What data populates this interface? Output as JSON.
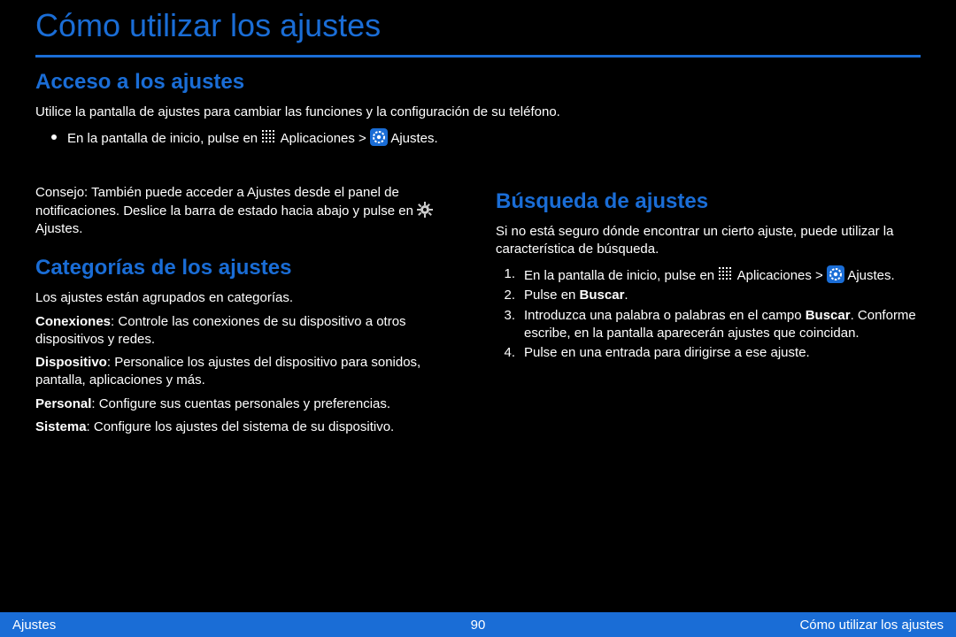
{
  "title": "Cómo utilizar los ajustes",
  "sections": {
    "acceso": {
      "heading": "Acceso a los ajustes",
      "intro": "Utilice la pantalla de ajustes para cambiar las funciones y la configuración de su teléfono.",
      "bullet_before": "En la pantalla de inicio, pulse en ",
      "bullet_middle": " Aplicaciones > ",
      "bullet_after": " Ajustes.",
      "tip_before": "Consejo: También puede acceder a Ajustes desde el panel de notificaciones. Deslice la barra de estado hacia abajo y pulse en ",
      "tip_after": " Ajustes."
    },
    "categorias": {
      "heading": "Categorías de los ajustes",
      "p1": "Los ajustes están agrupados en categorías.",
      "p2_before": "Conexiones",
      "p2_after": ": Controle las conexiones de su dispositivo a otros dispositivos y redes.",
      "p3_before": "Dispositivo",
      "p3_after": ": Personalice los ajustes del dispositivo para sonidos, pantalla, aplicaciones y más.",
      "p4_before": "Personal",
      "p4_after": ": Configure sus cuentas personales y preferencias.",
      "p5_before": "Sistema",
      "p5_after": ": Configure los ajustes del sistema de su dispositivo."
    },
    "busqueda": {
      "heading": "Búsqueda de ajustes",
      "intro": "Si no está seguro dónde encontrar un cierto ajuste, puede utilizar la característica de búsqueda.",
      "list": [
        {
          "n": "1.",
          "before": "En la pantalla de inicio, pulse en ",
          "mid": " Aplicaciones > ",
          "after": " Ajustes."
        },
        {
          "n": "2.",
          "before": "Pulse en ",
          "mid": "Buscar",
          "after": "."
        },
        {
          "n": "3.",
          "before": "Introduzca una palabra o palabras en el campo ",
          "mid": "Buscar",
          "after": ". Conforme escribe, en la pantalla aparecerán ajustes que coincidan."
        },
        {
          "n": "4.",
          "before": "Pulse en una entrada para dirigirse a ese ajuste.",
          "mid": "",
          "after": ""
        }
      ]
    }
  },
  "footer": {
    "left": "Ajustes",
    "page": "90",
    "right": "Cómo utilizar los ajustes"
  }
}
